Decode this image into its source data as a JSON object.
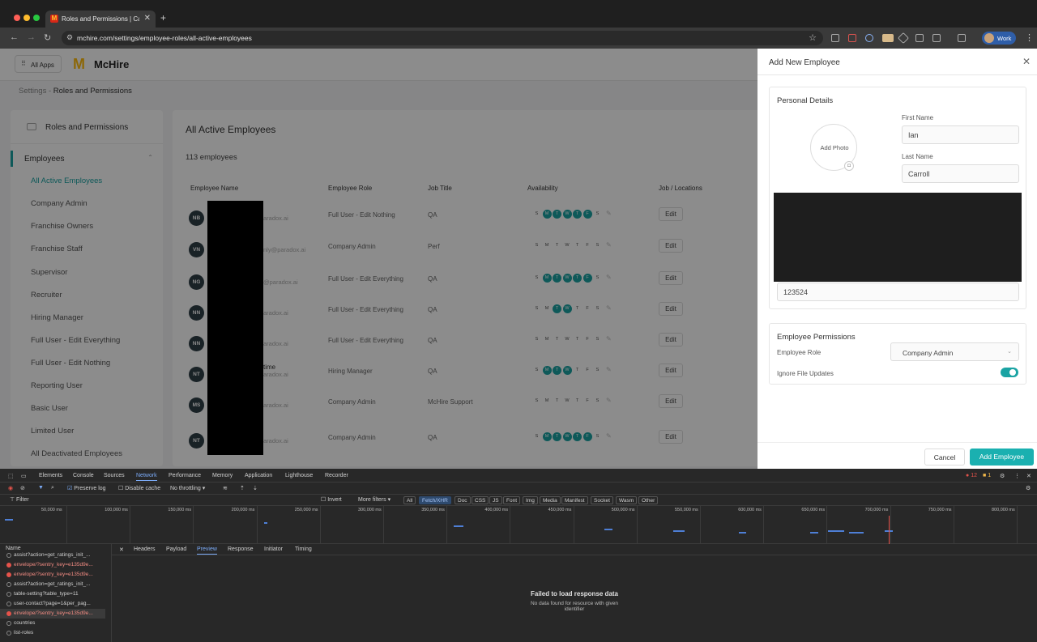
{
  "browser": {
    "tab_title": "Roles and Permissions | Cand",
    "tab_favicon": "M",
    "new_tab": "+",
    "url": "mchire.com/settings/employee-roles/all-active-employees",
    "profile_label": "Work"
  },
  "header": {
    "all_apps": "All Apps",
    "brand_mark": "M",
    "brand": "McHire"
  },
  "breadcrumb": {
    "parent": "Settings",
    "sep": " - ",
    "current": "Roles and Permissions"
  },
  "sidebar": {
    "title": "Roles and Permissions",
    "section": "Employees",
    "items": [
      {
        "label": "All Active Employees"
      },
      {
        "label": "Company Admin"
      },
      {
        "label": "Franchise Owners"
      },
      {
        "label": "Franchise Staff"
      },
      {
        "label": "Supervisor"
      },
      {
        "label": "Recruiter"
      },
      {
        "label": "Hiring Manager"
      },
      {
        "label": "Full User - Edit Everything"
      },
      {
        "label": "Full User - Edit Nothing"
      },
      {
        "label": "Reporting User"
      },
      {
        "label": "Basic User"
      },
      {
        "label": "Limited User"
      },
      {
        "label": "All Deactivated Employees"
      }
    ]
  },
  "main": {
    "title": "All Active Employees",
    "count": "113 employees",
    "columns": [
      "Employee Name",
      "Employee Role",
      "Job Title",
      "Availability",
      "Job / Locations"
    ],
    "day_letters": [
      "S",
      "M",
      "T",
      "W",
      "T",
      "F",
      "S"
    ],
    "edit_label": "Edit",
    "rows": [
      {
        "initials": "NB",
        "name": "",
        "email": "aradox.ai",
        "role": "Full User - Edit Nothing",
        "job": "QA",
        "days": [
          0,
          1,
          1,
          1,
          1,
          1,
          0
        ]
      },
      {
        "initials": "VN",
        "name": "",
        "email": "nly@paradox.ai",
        "role": "Company Admin",
        "job": "Perf",
        "days": [
          0,
          0,
          0,
          0,
          0,
          0,
          0
        ]
      },
      {
        "initials": "NG",
        "name": "",
        "email": "@paradox.ai",
        "role": "Full User - Edit Everything",
        "job": "QA",
        "days": [
          0,
          1,
          1,
          1,
          1,
          1,
          0
        ]
      },
      {
        "initials": "NN",
        "name": "",
        "email": "aradox.ai",
        "role": "Full User - Edit Everything",
        "job": "QA",
        "days": [
          0,
          0,
          1,
          1,
          0,
          0,
          0
        ]
      },
      {
        "initials": "NN",
        "name": "",
        "email": "aradox.ai",
        "role": "Full User - Edit Everything",
        "job": "QA",
        "days": [
          0,
          0,
          0,
          0,
          0,
          0,
          0
        ]
      },
      {
        "initials": "NT",
        "name": "time",
        "email": "aradox.ai",
        "role": "Hiring Manager",
        "job": "QA",
        "days": [
          0,
          1,
          1,
          1,
          0,
          0,
          0
        ]
      },
      {
        "initials": "MS",
        "name": "",
        "email": "aradox.ai",
        "role": "Company Admin",
        "job": "McHire Support",
        "days": [
          0,
          0,
          0,
          0,
          0,
          0,
          0
        ]
      },
      {
        "initials": "NT",
        "name": "",
        "email": "aradox.ai",
        "role": "Company Admin",
        "job": "QA",
        "days": [
          0,
          1,
          1,
          1,
          1,
          1,
          0
        ]
      }
    ]
  },
  "panel": {
    "title": "Add New Employee",
    "personal_details": "Personal Details",
    "add_photo": "Add Photo",
    "first_name_label": "First Name",
    "first_name_value": "Ian",
    "last_name_label": "Last Name",
    "last_name_value": "Carroll",
    "id_value": "123524",
    "permissions_title": "Employee Permissions",
    "role_label": "Employee Role",
    "role_value": "Company Admin",
    "ignore_label": "Ignore File Updates",
    "ignore_on": true,
    "cancel": "Cancel",
    "submit": "Add Employee"
  },
  "devtools": {
    "tabs": [
      "Elements",
      "Console",
      "Sources",
      "Network",
      "Performance",
      "Memory",
      "Application",
      "Lighthouse",
      "Recorder"
    ],
    "selected_tab": "Network",
    "error_count": "12",
    "warning_count": "1",
    "preserve_log": "Preserve log",
    "disable_cache": "Disable cache",
    "throttling": "No throttling",
    "filter_placeholder": "Filter",
    "invert": "Invert",
    "more_filters": "More filters",
    "type_filters": [
      "All",
      "Fetch/XHR",
      "Doc",
      "CSS",
      "JS",
      "Font",
      "Img",
      "Media",
      "Manifest",
      "Socket",
      "Wasm",
      "Other"
    ],
    "selected_filter": "Fetch/XHR",
    "timeline_ticks": [
      "50,000 ms",
      "100,000 ms",
      "150,000 ms",
      "200,000 ms",
      "250,000 ms",
      "300,000 ms",
      "350,000 ms",
      "400,000 ms",
      "450,000 ms",
      "500,000 ms",
      "550,000 ms",
      "600,000 ms",
      "650,000 ms",
      "700,000 ms",
      "750,000 ms",
      "800,000 ms"
    ],
    "name_header": "Name",
    "requests": [
      {
        "name": "assist?action=get_ratings_init_...",
        "status": "ok"
      },
      {
        "name": "envelope/?sentry_key=e135d9e...",
        "status": "error"
      },
      {
        "name": "envelope/?sentry_key=e135d9e...",
        "status": "error"
      },
      {
        "name": "assist?action=get_ratings_init_...",
        "status": "ok"
      },
      {
        "name": "table-setting?table_type=11",
        "status": "ok"
      },
      {
        "name": "user-contact?page=1&per_pag...",
        "status": "ok"
      },
      {
        "name": "envelope/?sentry_key=e135d9e...",
        "status": "error"
      },
      {
        "name": "countries",
        "status": "ok"
      },
      {
        "name": "list-roles",
        "status": "ok"
      }
    ],
    "detail_tabs": [
      "Headers",
      "Payload",
      "Preview",
      "Response",
      "Initiator",
      "Timing"
    ],
    "selected_detail_tab": "Preview",
    "message_title": "Failed to load response data",
    "message_body": "No data found for resource with given identifier"
  },
  "colors": {
    "accent": "#1aa3a3",
    "brand_yellow": "#ffbc0d",
    "error": "#e5534b",
    "devtools_blue": "#7cacf8"
  }
}
